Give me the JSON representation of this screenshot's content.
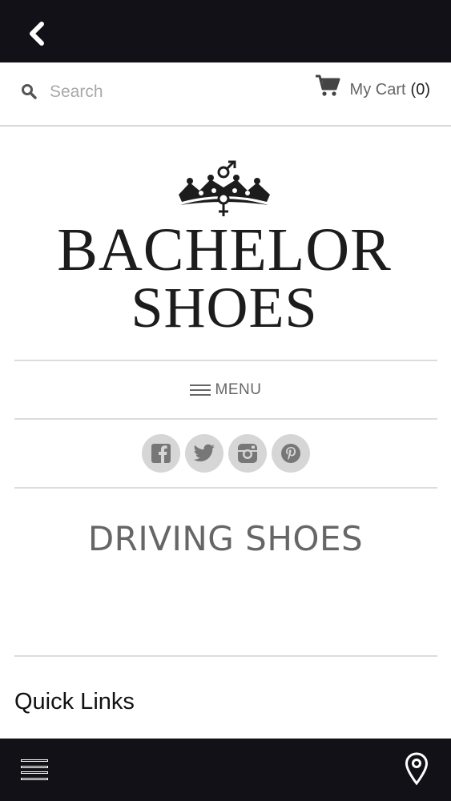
{
  "top_bar": {
    "back_icon": "chevron-left-icon"
  },
  "search": {
    "placeholder": "Search",
    "icon": "search-icon"
  },
  "cart": {
    "label": "My Cart",
    "count": "(0)",
    "icon": "cart-icon"
  },
  "logo": {
    "line1": "BACHELOR",
    "line2": "SHOES",
    "emblem": "crown-gender-emblem"
  },
  "menu": {
    "label": "MENU",
    "icon": "menu-lines-icon"
  },
  "social": [
    {
      "name": "facebook-icon"
    },
    {
      "name": "twitter-icon"
    },
    {
      "name": "instagram-icon"
    },
    {
      "name": "pinterest-icon"
    }
  ],
  "page": {
    "title": "DRIVING SHOES"
  },
  "footer": {
    "quick_links": "Quick Links"
  },
  "bottom_bar": {
    "menu_icon": "hamburger-icon",
    "location_icon": "location-pin-icon"
  },
  "colors": {
    "bar": "#121117",
    "divider": "#dcdcdc",
    "social_bg": "#d6d6d6",
    "muted_text": "#666666"
  }
}
